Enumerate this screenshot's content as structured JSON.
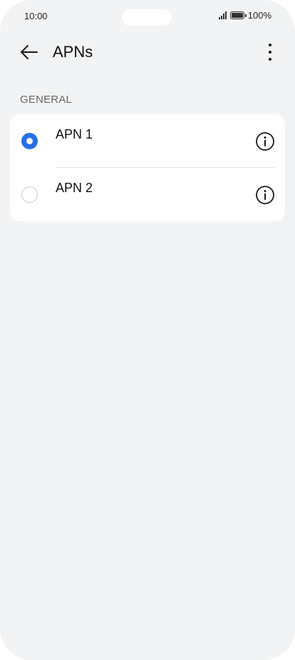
{
  "status_bar": {
    "time": "10:00",
    "battery": "100%"
  },
  "header": {
    "title": "APNs"
  },
  "section": {
    "title": "GENERAL"
  },
  "apns": [
    {
      "name": "APN 1",
      "selected": true
    },
    {
      "name": "APN 2",
      "selected": false
    }
  ],
  "colors": {
    "accent": "#256fe8",
    "background": "#f1f3f5",
    "card": "#ffffff"
  },
  "icons": {
    "back": "arrow-left-icon",
    "more": "more-vertical-icon",
    "info": "info-icon"
  }
}
